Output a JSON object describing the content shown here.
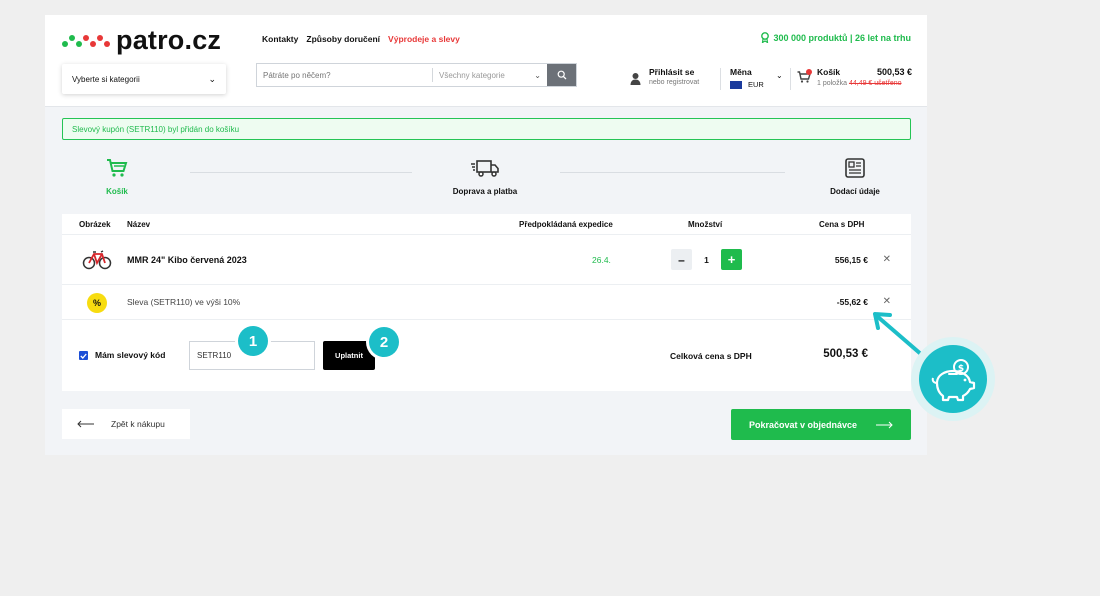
{
  "brand": {
    "name": "patro.cz",
    "accent": "#1fbb4d",
    "sale_color": "#e83838",
    "teal": "#1cbec8"
  },
  "topnav": {
    "contacts": "Kontakty",
    "delivery": "Způsoby doručení",
    "sale": "Výprodeje a slevy"
  },
  "usp": "300 000 produktů | 26 let na trhu",
  "category_select": {
    "label": "Vyberte si kategorii"
  },
  "search": {
    "placeholder": "Pátráte po něčem?",
    "scope": "Všechny kategorie"
  },
  "account": {
    "login": "Přihlásit se",
    "register": "nebo registrovat"
  },
  "currency": {
    "label": "Měna",
    "value": "EUR"
  },
  "cart": {
    "label": "Košík",
    "total": "500,53 €",
    "items": "1 položka",
    "saved": "44,49 € ušetřeno"
  },
  "alert": "Slevový kupón (SETR110) byl přidán do košíku",
  "steps": [
    {
      "label": "Košík",
      "icon": "cart-icon"
    },
    {
      "label": "Doprava a platba",
      "icon": "truck-icon"
    },
    {
      "label": "Dodací údaje",
      "icon": "form-icon"
    }
  ],
  "table": {
    "headers": {
      "image": "Obrázek",
      "name": "Název",
      "expedition": "Předpokládaná expedice",
      "quantity": "Množství",
      "price": "Cena s DPH"
    },
    "items": [
      {
        "name": "MMR 24\" Kibo červená 2023",
        "expedition": "26.4.",
        "quantity": "1",
        "price": "556,15 €",
        "image": "bike-icon"
      }
    ],
    "discount": {
      "name": "Sleva (SETR110) ve výši 10%",
      "price": "-55,62 €",
      "symbol": "%"
    }
  },
  "coupon": {
    "checkbox_label": "Mám slevový kód",
    "value": "SETR110",
    "apply": "Uplatnit",
    "checked": true
  },
  "totals": {
    "label": "Celková cena s DPH",
    "value": "500,53 €"
  },
  "nav": {
    "back": "Zpět k nákupu",
    "continue": "Pokračovat v objednávce"
  },
  "annotations": {
    "badge1": "1",
    "badge2": "2"
  }
}
